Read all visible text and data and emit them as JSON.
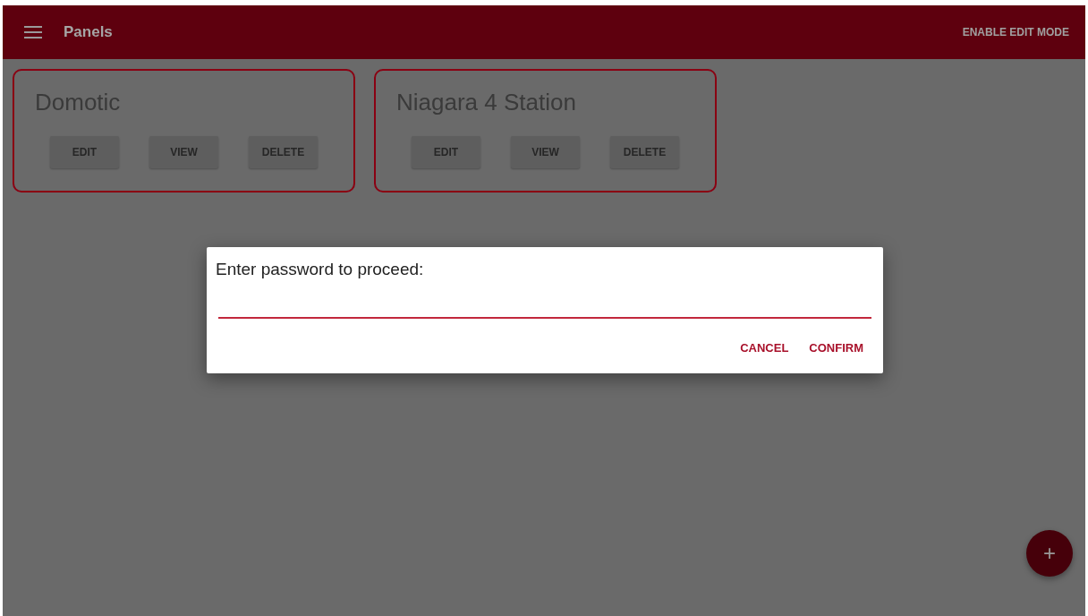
{
  "app_bar": {
    "title": "Panels",
    "action": "ENABLE EDIT MODE"
  },
  "panels": [
    {
      "title": "Domotic",
      "buttons": [
        "EDIT",
        "VIEW",
        "DELETE"
      ]
    },
    {
      "title": "Niagara 4 Station",
      "buttons": [
        "EDIT",
        "VIEW",
        "DELETE"
      ]
    }
  ],
  "dialog": {
    "prompt": "Enter password to proceed:",
    "buttons": [
      "CANCEL",
      "CONFIRM"
    ]
  },
  "fab": {
    "label": "+"
  }
}
